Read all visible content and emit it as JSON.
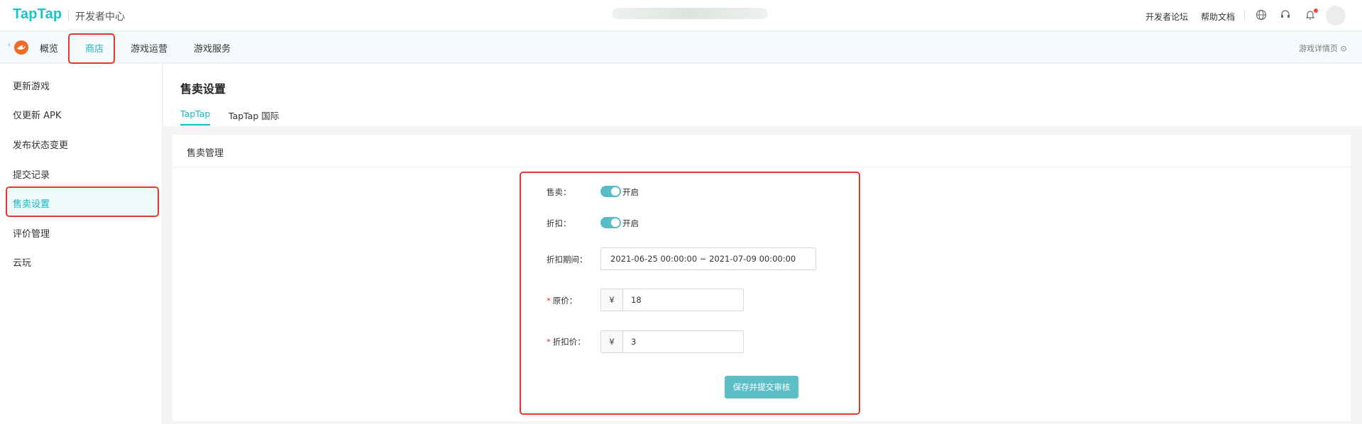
{
  "header": {
    "logo": "TapTap",
    "subtitle": "开发者中心",
    "links": [
      "开发者论坛",
      "帮助文档"
    ]
  },
  "nav": {
    "tabs": [
      "概览",
      "商店",
      "游戏运营",
      "游戏服务"
    ],
    "active_tab": "商店",
    "right_link": "游戏详情页",
    "right_icon": "⊙"
  },
  "sidebar": {
    "items": [
      "更新游戏",
      "仅更新 APK",
      "发布状态变更",
      "提交记录",
      "售卖设置",
      "评价管理",
      "云玩"
    ],
    "active_item": "售卖设置"
  },
  "page": {
    "title": "售卖设置",
    "tabs": [
      "TapTap",
      "TapTap 国际"
    ],
    "active_tab": "TapTap"
  },
  "card": {
    "title": "售卖管理",
    "sale_label": "售卖：",
    "sale_state": "开启",
    "discount_label": "折扣：",
    "discount_state": "开启",
    "period_label": "折扣期间：",
    "period_value": "2021-06-25 00:00:00 ~ 2021-07-09 00:00:00",
    "original_price_label": "原价：",
    "discount_price_label": "折扣价：",
    "currency_prefix": "¥",
    "original_price": "18",
    "discount_price": "3",
    "required_mark": "*",
    "submit_label": "保存并提交审核"
  },
  "colors": {
    "brand": "#15c5ce",
    "active": "#15b8c2",
    "highlight": "#dd3a2e",
    "toggle": "#56bdc6"
  }
}
